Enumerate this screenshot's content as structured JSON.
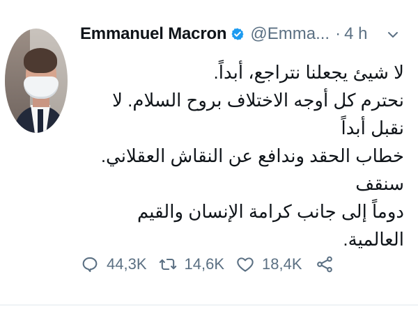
{
  "account": {
    "name": "Emmanuel Macron",
    "handle": "@Emma...",
    "separator": "·",
    "time": "4 h"
  },
  "tweet": {
    "lines": [
      "لا شيئ يجعلنا نتراجع، أبداً.",
      "نحترم كل أوجه الاختلاف بروح السلام. لا نقبل أبداً",
      "خطاب الحقد وندافع عن النقاش العقلاني. سنقف",
      "دوماً إلى جانب كرامة الإنسان والقيم العالمية."
    ]
  },
  "actions": {
    "reply_count": "44,3K",
    "retweet_count": "14,6K",
    "like_count": "18,4K"
  },
  "icons": {
    "verified": "verified-badge-icon",
    "menu": "chevron-down-icon",
    "reply": "reply-icon",
    "retweet": "retweet-icon",
    "like": "heart-icon",
    "share": "share-icon"
  },
  "colors": {
    "text": "#0f1419",
    "secondary": "#5b7083",
    "verified": "#1d9bf0"
  }
}
